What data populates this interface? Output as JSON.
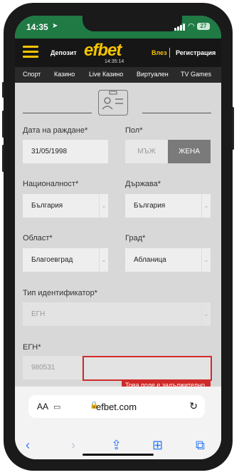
{
  "status_bar": {
    "time": "14:35",
    "battery": "27"
  },
  "header": {
    "deposit": "Депозит",
    "logo": "efbet",
    "clock": "14:35:14",
    "login": "Влез",
    "register": "Регистрация"
  },
  "nav": [
    "Спорт",
    "Казино",
    "Live Казино",
    "Виртуален",
    "TV Games"
  ],
  "form": {
    "birth_date_label": "Дата на раждане*",
    "birth_date_value": "31/05/1998",
    "gender_label": "Пол*",
    "gender_male": "МЪЖ",
    "gender_female": "ЖЕНА",
    "nationality_label": "Националност*",
    "nationality_value": "България",
    "country_label": "Държава*",
    "country_value": "България",
    "region_label": "Област*",
    "region_value": "Благоевград",
    "city_label": "Град*",
    "city_value": "Абланица",
    "id_type_label": "Тип идентификатор*",
    "id_type_value": "ЕГН",
    "egn_label": "ЕГН*",
    "egn_prefix": "980531",
    "error_message": "Това поле е задължително."
  },
  "safari": {
    "aa": "AA",
    "url": "efbet.com"
  },
  "icons": {
    "menu": "hamburger-icon",
    "id_card": "id-card-icon",
    "lock": "lock-icon",
    "reload": "reload-icon",
    "back": "chevron-left-icon",
    "forward": "chevron-right-icon",
    "share": "share-icon",
    "bookmarks": "book-icon",
    "tabs": "tabs-icon"
  },
  "colors": {
    "accent": "#f5c400",
    "status_bar": "#1f7a44",
    "error": "#d12a2a",
    "link": "#2f7bf6"
  }
}
